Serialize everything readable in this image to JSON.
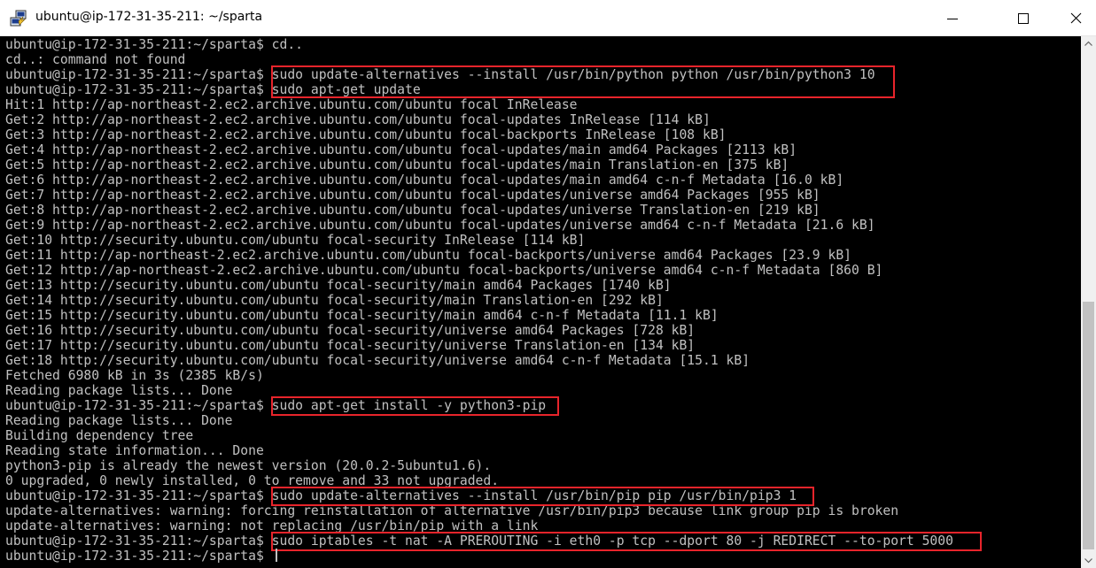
{
  "window": {
    "title": "ubuntu@ip-172-31-35-211: ~/sparta",
    "icon": "putty-icon"
  },
  "controls": {
    "minimize": "minimize-icon",
    "maximize": "maximize-icon",
    "close": "close-icon"
  },
  "terminal": {
    "lines": [
      "ubuntu@ip-172-31-35-211:~/sparta$ cd..",
      "cd..: command not found",
      "ubuntu@ip-172-31-35-211:~/sparta$ sudo update-alternatives --install /usr/bin/python python /usr/bin/python3 10",
      "ubuntu@ip-172-31-35-211:~/sparta$ sudo apt-get update",
      "Hit:1 http://ap-northeast-2.ec2.archive.ubuntu.com/ubuntu focal InRelease",
      "Get:2 http://ap-northeast-2.ec2.archive.ubuntu.com/ubuntu focal-updates InRelease [114 kB]",
      "Get:3 http://ap-northeast-2.ec2.archive.ubuntu.com/ubuntu focal-backports InRelease [108 kB]",
      "Get:4 http://ap-northeast-2.ec2.archive.ubuntu.com/ubuntu focal-updates/main amd64 Packages [2113 kB]",
      "Get:5 http://ap-northeast-2.ec2.archive.ubuntu.com/ubuntu focal-updates/main Translation-en [375 kB]",
      "Get:6 http://ap-northeast-2.ec2.archive.ubuntu.com/ubuntu focal-updates/main amd64 c-n-f Metadata [16.0 kB]",
      "Get:7 http://ap-northeast-2.ec2.archive.ubuntu.com/ubuntu focal-updates/universe amd64 Packages [955 kB]",
      "Get:8 http://ap-northeast-2.ec2.archive.ubuntu.com/ubuntu focal-updates/universe Translation-en [219 kB]",
      "Get:9 http://ap-northeast-2.ec2.archive.ubuntu.com/ubuntu focal-updates/universe amd64 c-n-f Metadata [21.6 kB]",
      "Get:10 http://security.ubuntu.com/ubuntu focal-security InRelease [114 kB]",
      "Get:11 http://ap-northeast-2.ec2.archive.ubuntu.com/ubuntu focal-backports/universe amd64 Packages [23.9 kB]",
      "Get:12 http://ap-northeast-2.ec2.archive.ubuntu.com/ubuntu focal-backports/universe amd64 c-n-f Metadata [860 B]",
      "Get:13 http://security.ubuntu.com/ubuntu focal-security/main amd64 Packages [1740 kB]",
      "Get:14 http://security.ubuntu.com/ubuntu focal-security/main Translation-en [292 kB]",
      "Get:15 http://security.ubuntu.com/ubuntu focal-security/main amd64 c-n-f Metadata [11.1 kB]",
      "Get:16 http://security.ubuntu.com/ubuntu focal-security/universe amd64 Packages [728 kB]",
      "Get:17 http://security.ubuntu.com/ubuntu focal-security/universe Translation-en [134 kB]",
      "Get:18 http://security.ubuntu.com/ubuntu focal-security/universe amd64 c-n-f Metadata [15.1 kB]",
      "Fetched 6980 kB in 3s (2385 kB/s)",
      "Reading package lists... Done",
      "ubuntu@ip-172-31-35-211:~/sparta$ sudo apt-get install -y python3-pip",
      "Reading package lists... Done",
      "Building dependency tree",
      "Reading state information... Done",
      "python3-pip is already the newest version (20.0.2-5ubuntu1.6).",
      "0 upgraded, 0 newly installed, 0 to remove and 33 not upgraded.",
      "ubuntu@ip-172-31-35-211:~/sparta$ sudo update-alternatives --install /usr/bin/pip pip /usr/bin/pip3 1",
      "update-alternatives: warning: forcing reinstallation of alternative /usr/bin/pip3 because link group pip is broken",
      "update-alternatives: warning: not replacing /usr/bin/pip with a link",
      "ubuntu@ip-172-31-35-211:~/sparta$ sudo iptables -t nat -A PREROUTING -i eth0 -p tcp --dport 80 -j REDIRECT --to-port 5000",
      "ubuntu@ip-172-31-35-211:~/sparta$ "
    ],
    "highlight_color": "#e8242b",
    "text_color": "#c0c0c0",
    "background": "#000000"
  }
}
